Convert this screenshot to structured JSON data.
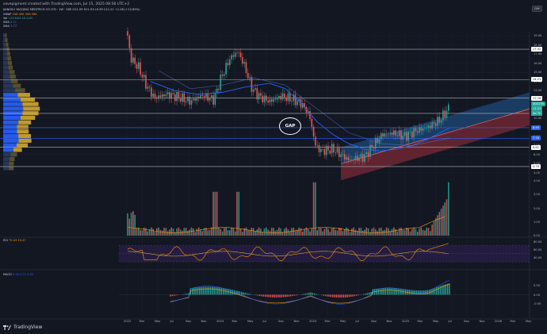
{
  "credit": "savepigment created with TradingView.com, Jul 15, 2025 08:58 UTC+2",
  "legend": {
    "symbol_line": "JIANGSU YAOQING MEDITECH CO LTD · 1W · SSE  O11.99  H11.93  L9.99  C11.21  +1.28 (+12.89%)",
    "vwap": {
      "label": "VWAP",
      "values": "246.45K  306.39K"
    },
    "vol": {
      "label": "Vol",
      "values": "103.84M  48.24M"
    },
    "sma1": {
      "label": "SMA",
      "value": "8.91"
    },
    "sma2": {
      "label": "SMA",
      "value": "7.77"
    }
  },
  "currency": "CNY",
  "gap_label": "GAP",
  "price_axis": {
    "ticks": [
      "19.00",
      "18.00",
      "17.00",
      "16.00",
      "15.00",
      "14.00",
      "13.00",
      "12.00",
      "11.00",
      "10.00",
      "9.00",
      "8.00",
      "7.00",
      "6.00",
      "5.00",
      "4.00"
    ],
    "labels": [
      {
        "text": "17.52",
        "color": "#ffffff",
        "price": 17.52
      },
      {
        "text": "14.21",
        "color": "#ffffff",
        "price": 14.21
      },
      {
        "text": "12.18",
        "color": "#ffffff",
        "price": 12.18
      },
      {
        "text": "10.51",
        "color": "#ffffff",
        "price": 10.51
      },
      {
        "text": "8.95",
        "color": "#2962ff",
        "price": 8.95
      },
      {
        "text": "7.78",
        "color": "#2962ff",
        "price": 7.78
      },
      {
        "text": "6.81",
        "color": "#ffffff",
        "price": 6.81
      },
      {
        "text": "4.70",
        "color": "#ffffff",
        "price": 4.7
      }
    ],
    "current": {
      "symbol": "300176",
      "price": "11.21",
      "countdown": "5d 7h"
    }
  },
  "volume_axis": {
    "ticks": [
      "4.00",
      "3.00",
      "2.00",
      "1.00",
      "0.00"
    ]
  },
  "rsi": {
    "title": "RSI",
    "values": "75.43  43.47",
    "ticks": [
      "80.00",
      "60.00",
      "40.00"
    ]
  },
  "macd": {
    "title": "MACD",
    "values": "0.20  0.71  0.52",
    "ticks": [
      "0.50",
      "0.00",
      "-0.50"
    ]
  },
  "time_axis": [
    "2022",
    "Mar",
    "May",
    "Jul",
    "Sep",
    "Nov",
    "2023",
    "Mar",
    "May",
    "Jul",
    "Sep",
    "Nov",
    "2024",
    "Mar",
    "May",
    "Jul",
    "Sep",
    "Nov",
    "2025",
    "Mar",
    "May",
    "Jul",
    "Sep",
    "Nov",
    "2026",
    "Mar",
    "May"
  ],
  "brand": "TradingView",
  "colors": {
    "bg": "#131722",
    "up": "#26a69a",
    "down": "#ef5350",
    "sma": "#2962ff",
    "vwap": "#ff9800",
    "channel_up": "#1e4a7a",
    "channel_down": "#7a2a36",
    "vp_up": "#2962ff",
    "vp_down": "#d4a72c"
  }
}
